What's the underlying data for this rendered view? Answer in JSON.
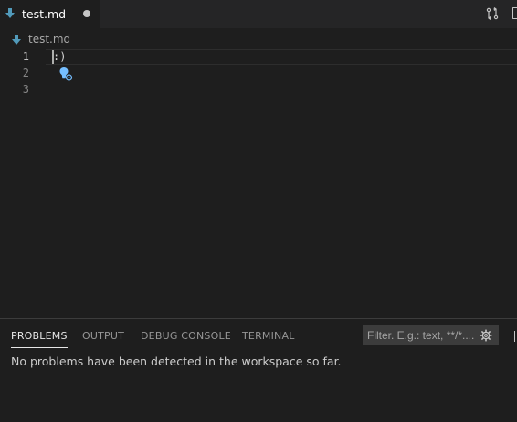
{
  "tabs": [
    {
      "label": "test.md",
      "dirty": true
    }
  ],
  "breadcrumb": {
    "file": "test.md"
  },
  "editor": {
    "lines": [
      {
        "number": "1",
        "text": ":)",
        "active": true
      },
      {
        "number": "2",
        "text": ""
      },
      {
        "number": "3",
        "text": ""
      }
    ],
    "cursor_line": 1
  },
  "panel": {
    "tabs": [
      {
        "label": "PROBLEMS",
        "active": true
      },
      {
        "label": "OUTPUT"
      },
      {
        "label": "DEBUG CONSOLE"
      },
      {
        "label": "TERMINAL"
      }
    ],
    "filter_placeholder": "Filter. E.g.: text, **/*....",
    "message": "No problems have been detected in the workspace so far."
  },
  "colors": {
    "markdown_icon": "#519aba",
    "lightbulb": "#75beff",
    "active_line_number": "#c6c6c6",
    "line_number": "#858585"
  },
  "icons": {
    "file": "markdown-arrow-icon",
    "compare": "open-changes-icon",
    "split": "split-editor-icon",
    "code_action": "lightbulb-icon",
    "filter_settings": "gear-icon"
  }
}
